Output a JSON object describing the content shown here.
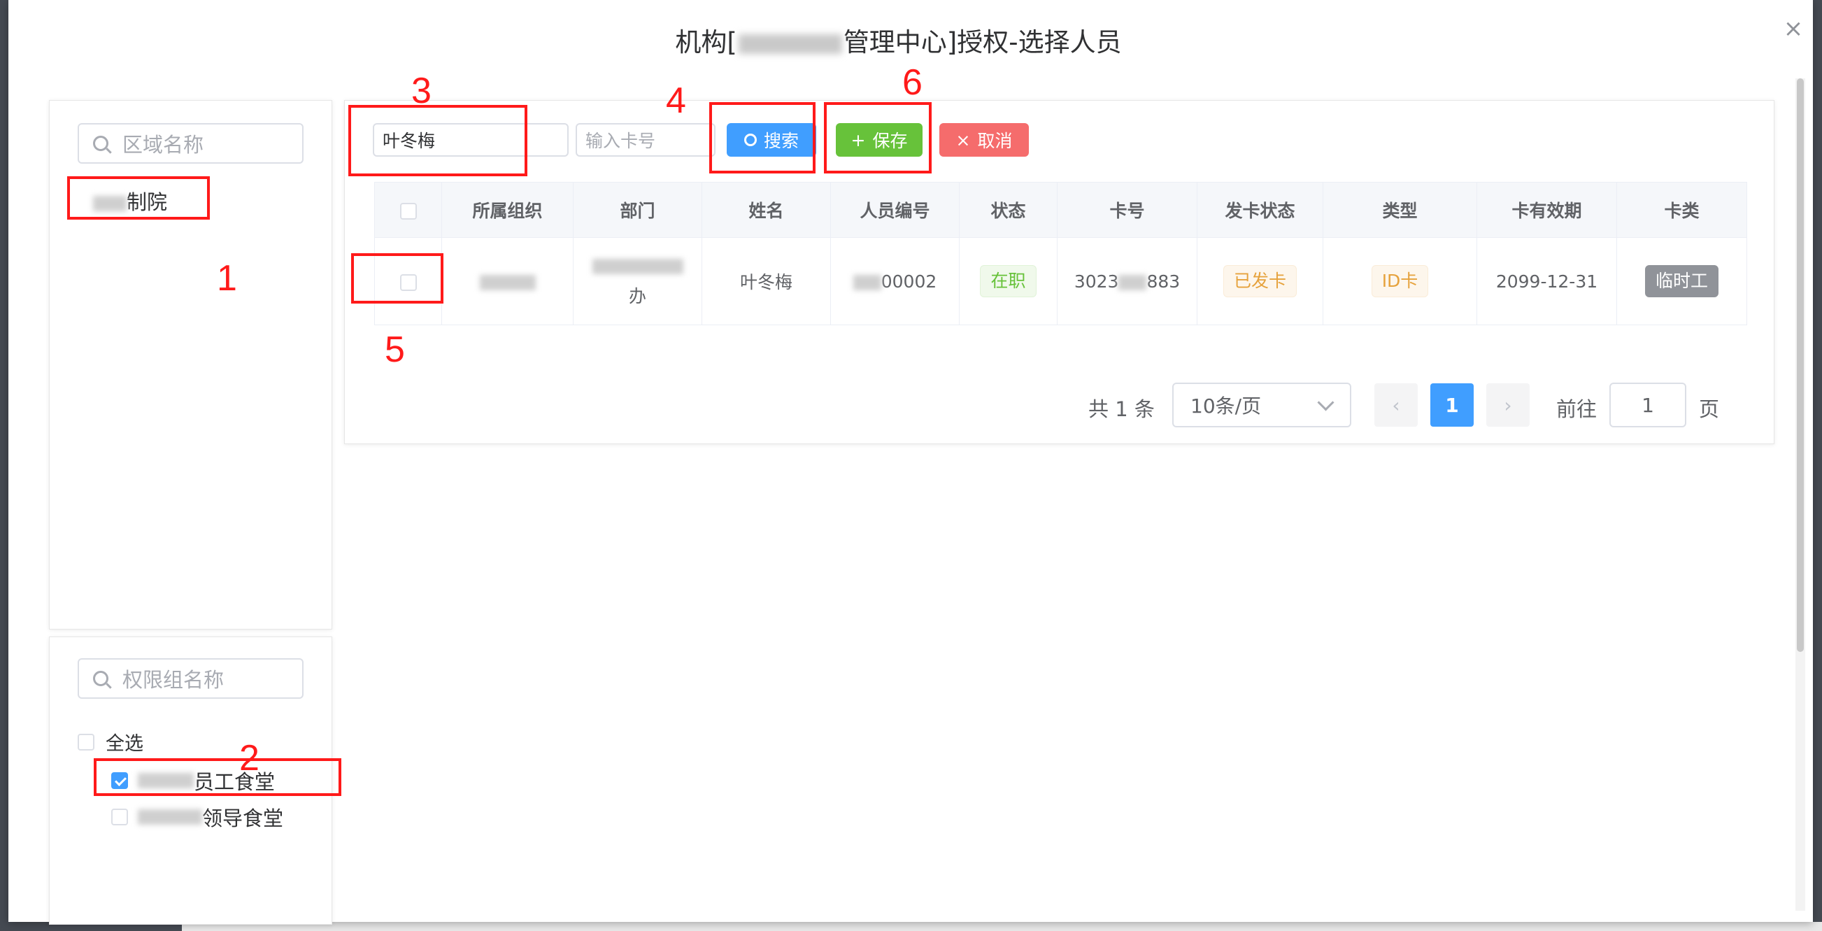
{
  "dialog": {
    "title_prefix": "机构[",
    "title_suffix": "管理中心]授权-选择人员",
    "close": "×"
  },
  "area_tree": {
    "search_placeholder": "区域名称",
    "node_label_suffix": "制院"
  },
  "perm_groups": {
    "search_placeholder": "权限组名称",
    "select_all": "全选",
    "items": [
      {
        "label_suffix": "员工食堂",
        "checked": true
      },
      {
        "label_suffix": "领导食堂",
        "checked": false
      }
    ]
  },
  "toolbar": {
    "name_value": "叶冬梅",
    "card_placeholder": "输入卡号",
    "search_label": "搜索",
    "save_label": "保存",
    "cancel_label": "取消"
  },
  "table": {
    "headers": [
      "所属组织",
      "部门",
      "姓名",
      "人员编号",
      "状态",
      "卡号",
      "发卡状态",
      "类型",
      "卡有效期",
      "卡类"
    ],
    "rows": [
      {
        "dept_suffix": "办",
        "name": "叶冬梅",
        "emp_no_suffix": "00002",
        "status": "在职",
        "card_prefix": "3023",
        "card_suffix": "883",
        "issue_status": "已发卡",
        "type": "ID卡",
        "expiry": "2099-12-31",
        "card_class": "临时工"
      }
    ]
  },
  "pagination": {
    "total": "共 1 条",
    "page_size": "10条/页",
    "current_page": "1",
    "goto_label": "前往",
    "goto_value": "1",
    "page_unit": "页"
  },
  "annotations": [
    "1",
    "2",
    "3",
    "4",
    "5",
    "6"
  ],
  "colors": {
    "primary": "#409eff",
    "success": "#67c23a",
    "danger": "#f56c6c",
    "annotation": "#ff1a1a"
  }
}
